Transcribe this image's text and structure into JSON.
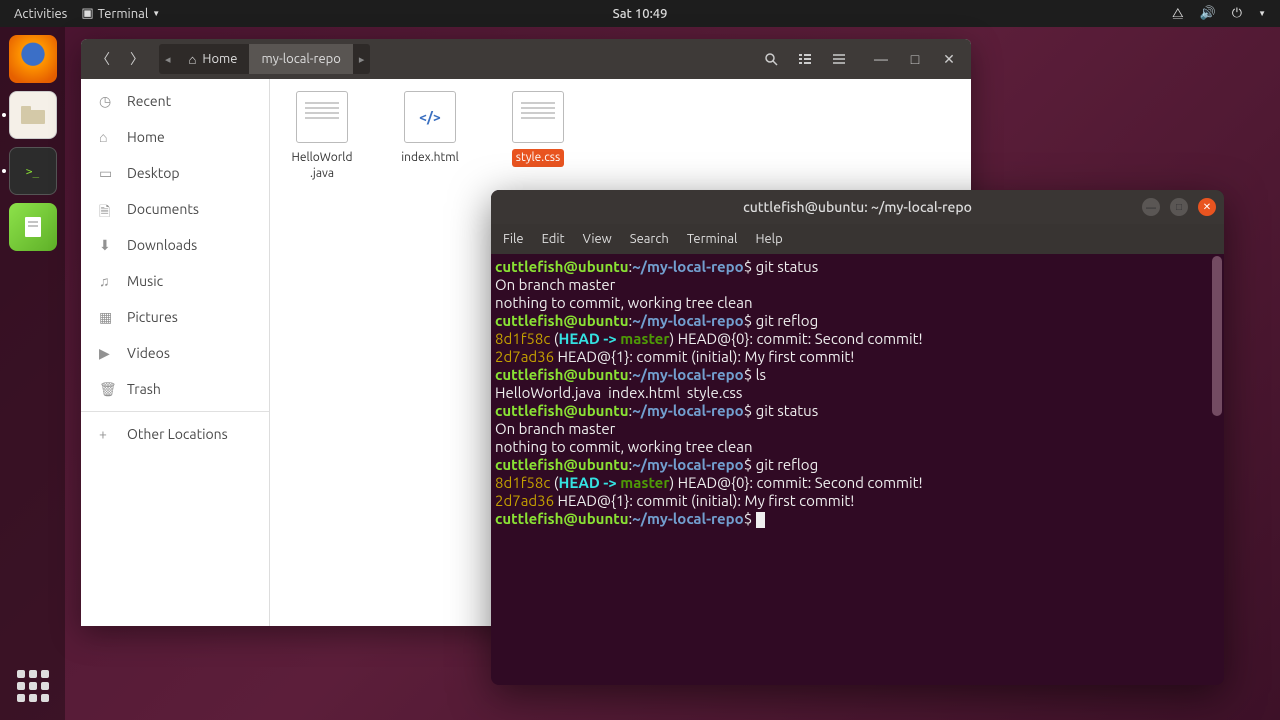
{
  "topbar": {
    "activities": "Activities",
    "app": "Terminal",
    "clock": "Sat 10:49"
  },
  "files": {
    "path": {
      "home": "Home",
      "current": "my-local-repo"
    },
    "sidebar": [
      "Recent",
      "Home",
      "Desktop",
      "Documents",
      "Downloads",
      "Music",
      "Pictures",
      "Videos",
      "Trash",
      "Other Locations"
    ],
    "items": [
      {
        "name": "HelloWorld\n.java",
        "kind": "text"
      },
      {
        "name": "index.html",
        "kind": "html"
      },
      {
        "name": "style.css",
        "kind": "text",
        "selected": true
      }
    ]
  },
  "terminal": {
    "title": "cuttlefish@ubuntu: ~/my-local-repo",
    "menu": [
      "File",
      "Edit",
      "View",
      "Search",
      "Terminal",
      "Help"
    ],
    "prompt_user": "cuttlefish@ubuntu",
    "prompt_path": "~/my-local-repo",
    "lines": [
      {
        "type": "prompt",
        "cmd": "git status"
      },
      {
        "type": "out",
        "text": "On branch master"
      },
      {
        "type": "out",
        "text": "nothing to commit, working tree clean"
      },
      {
        "type": "prompt",
        "cmd": "git reflog"
      },
      {
        "type": "reflog",
        "hash": "8d1f58c",
        "ref": "HEAD -> master",
        "rest": "HEAD@{0}: commit: Second commit!"
      },
      {
        "type": "reflog",
        "hash": "2d7ad36",
        "ref": null,
        "rest": "HEAD@{1}: commit (initial): My first commit!"
      },
      {
        "type": "prompt",
        "cmd": "ls"
      },
      {
        "type": "out",
        "text": "HelloWorld.java  index.html  style.css"
      },
      {
        "type": "prompt",
        "cmd": "git status"
      },
      {
        "type": "out",
        "text": "On branch master"
      },
      {
        "type": "out",
        "text": "nothing to commit, working tree clean"
      },
      {
        "type": "prompt",
        "cmd": "git reflog"
      },
      {
        "type": "reflog",
        "hash": "8d1f58c",
        "ref": "HEAD -> master",
        "rest": "HEAD@{0}: commit: Second commit!"
      },
      {
        "type": "reflog",
        "hash": "2d7ad36",
        "ref": null,
        "rest": "HEAD@{1}: commit (initial): My first commit!"
      },
      {
        "type": "prompt",
        "cmd": "",
        "cursor": true
      }
    ]
  }
}
